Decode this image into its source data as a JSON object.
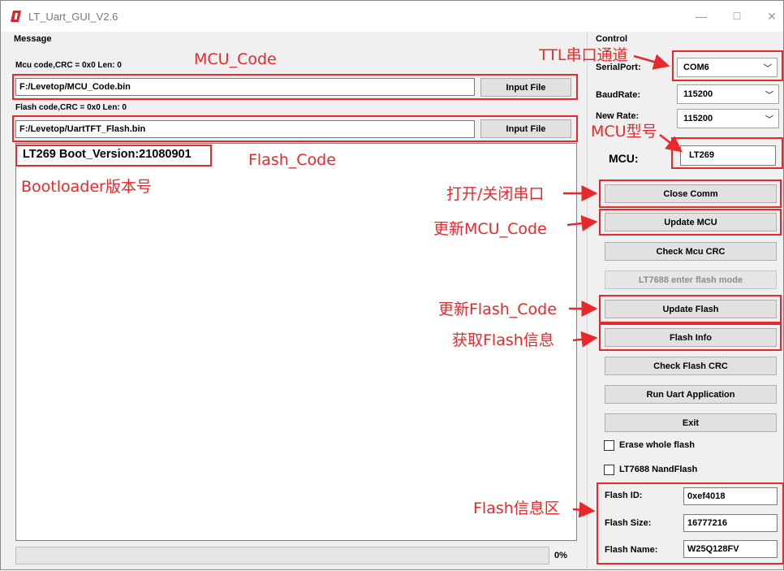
{
  "window": {
    "title": "LT_Uart_GUI_V2.6"
  },
  "message": {
    "group_label": "Message",
    "mcu_code_label": "Mcu code,CRC = 0x0  Len: 0",
    "mcu_path": "F:/Levetop/MCU_Code.bin",
    "flash_code_label": "Flash code,CRC = 0x0  Len: 0",
    "flash_path": "F:/Levetop/UartTFT_Flash.bin",
    "input_file_label": "Input File",
    "boot_version": "LT269 Boot_Version:21080901",
    "progress_text": "0%",
    "progress_value": 0
  },
  "control": {
    "group_label": "Control",
    "serial_port_label": "SerialPort:",
    "serial_port_value": "COM6",
    "baud_rate_label": "BaudRate:",
    "baud_rate_value": "115200",
    "new_rate_label": "New Rate:",
    "new_rate_value": "115200",
    "mcu_label": "MCU:",
    "mcu_value": "LT269",
    "buttons": {
      "close_comm": "Close Comm",
      "update_mcu": "Update MCU",
      "check_mcu_crc": "Check Mcu CRC",
      "lt7688_flash_mode": "LT7688 enter flash mode",
      "update_flash": "Update Flash",
      "flash_info": "Flash Info",
      "check_flash_crc": "Check Flash CRC",
      "run_uart_app": "Run Uart Application",
      "exit": "Exit"
    },
    "erase_whole_flash_label": "Erase whole flash",
    "nandflash_label": "LT7688 NandFlash",
    "flash_id_label": "Flash ID:",
    "flash_id_value": "0xef4018",
    "flash_size_label": "Flash Size:",
    "flash_size_value": "16777216",
    "flash_name_label": "Flash Name:",
    "flash_name_value": "W25Q128FV"
  },
  "annotations": {
    "mcu_code": "MCU_Code",
    "flash_code": "Flash_Code",
    "bootloader_version": "Bootloader版本号",
    "ttl_channel": "TTL串口通道",
    "mcu_model": "MCU型号",
    "open_close_port": "打开/关闭串口",
    "update_mcu_code": "更新MCU_Code",
    "update_flash_code": "更新Flash_Code",
    "get_flash_info": "获取Flash信息",
    "flash_info_area": "Flash信息区"
  },
  "colors": {
    "annotation_red": "#e8292b"
  }
}
